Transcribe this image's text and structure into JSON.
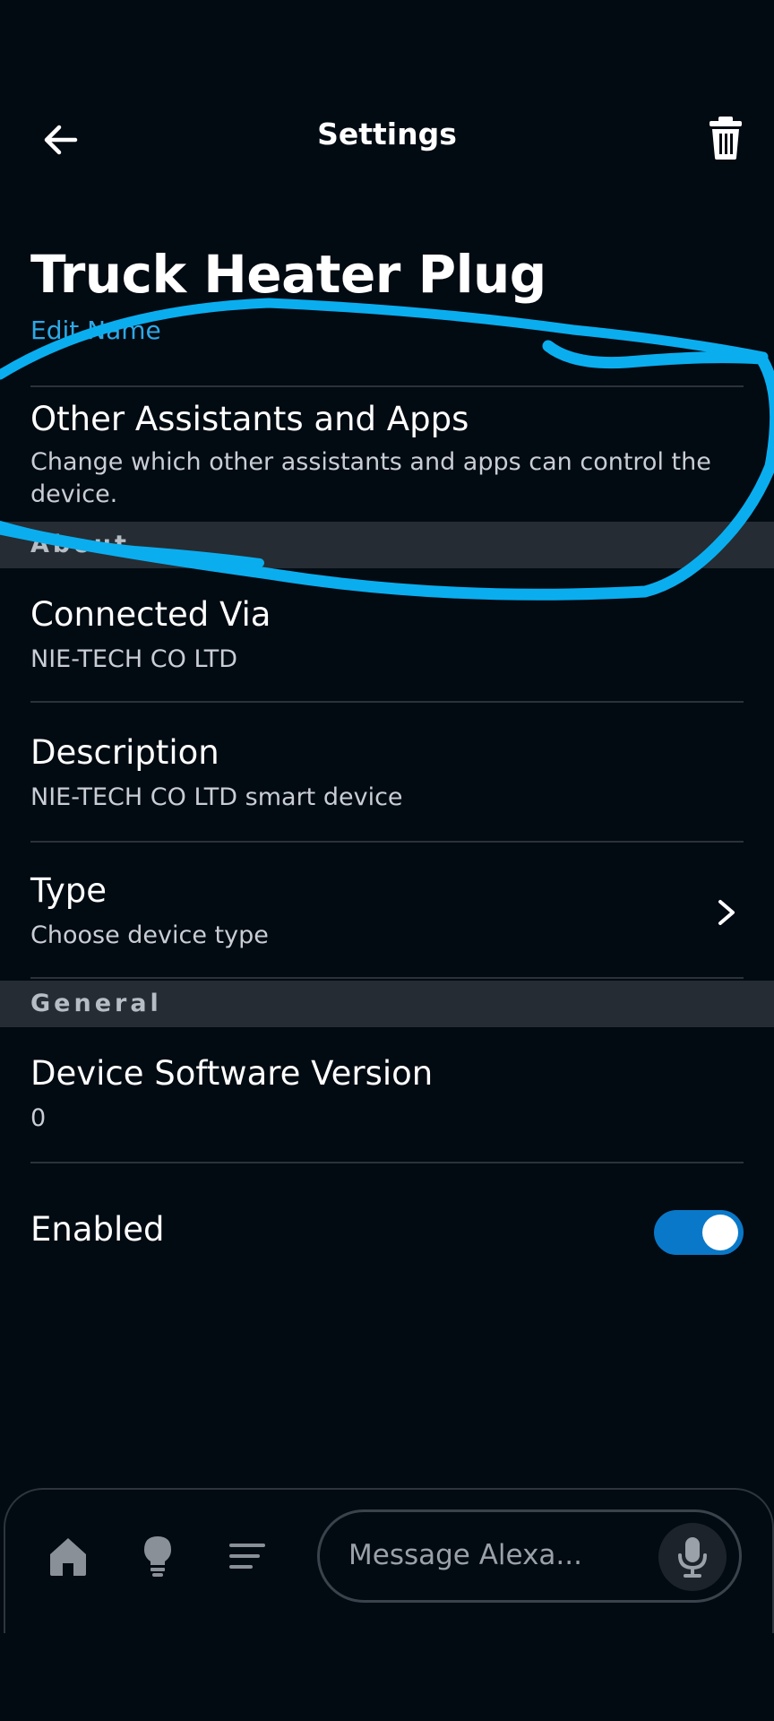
{
  "header": {
    "title": "Settings"
  },
  "device": {
    "name": "Truck Heater Plug",
    "edit_label": "Edit Name"
  },
  "assistants": {
    "title": "Other Assistants and Apps",
    "subtitle": "Change which other assistants and apps can control the device."
  },
  "about": {
    "section_label": "About",
    "connected_via": {
      "title": "Connected Via",
      "value": "NIE-TECH CO LTD"
    },
    "description": {
      "title": "Description",
      "value": "NIE-TECH CO LTD smart device"
    },
    "type": {
      "title": "Type",
      "value": "Choose device type"
    }
  },
  "general": {
    "section_label": "General",
    "software_version": {
      "title": "Device Software Version",
      "value": "0"
    },
    "enabled": {
      "title": "Enabled",
      "state": "on"
    }
  },
  "bottom_nav": {
    "items": [
      "home-icon",
      "lightbulb-icon",
      "list-icon"
    ],
    "message_placeholder": "Message Alexa..."
  },
  "colors": {
    "background": "#020a12",
    "accent": "#2ea8e6",
    "toggle_on": "#0a78c8",
    "annotation": "#0aaeef"
  }
}
